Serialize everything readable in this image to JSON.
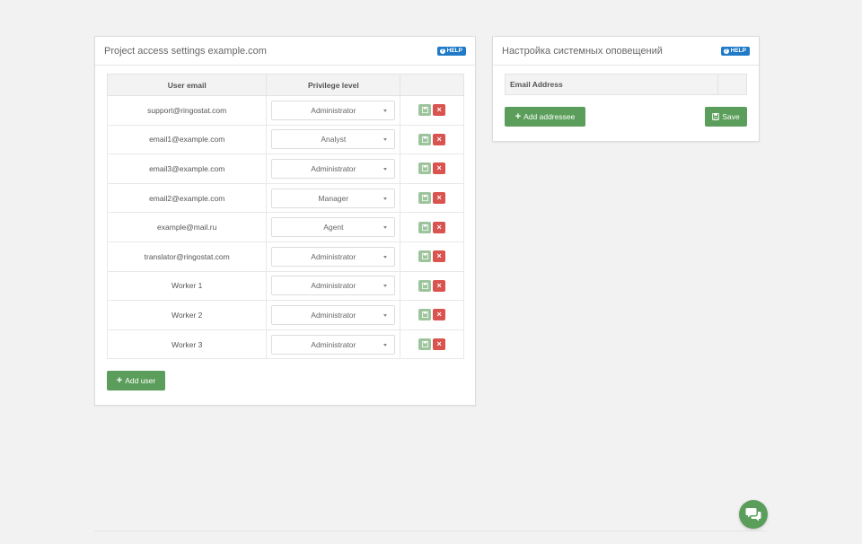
{
  "access_panel": {
    "title": "Project access settings example.com",
    "help_label": "HELP",
    "table": {
      "headers": [
        "User email",
        "Privilege level",
        ""
      ],
      "rows": [
        {
          "email": "support@ringostat.com",
          "privilege": "Administrator"
        },
        {
          "email": "email1@example.com",
          "privilege": "Analyst"
        },
        {
          "email": "email3@example.com",
          "privilege": "Administrator"
        },
        {
          "email": "email2@example.com",
          "privilege": "Manager"
        },
        {
          "email": "example@mail.ru",
          "privilege": "Agent"
        },
        {
          "email": "translator@ringostat.com",
          "privilege": "Administrator"
        },
        {
          "email": "Worker 1",
          "privilege": "Administrator"
        },
        {
          "email": "Worker 2",
          "privilege": "Administrator"
        },
        {
          "email": "Worker 3",
          "privilege": "Administrator"
        }
      ]
    },
    "add_user_label": "Add user"
  },
  "notifications_panel": {
    "title": "Настройка системных оповещений",
    "help_label": "HELP",
    "table_header": "Email Address",
    "add_addressee_label": "Add addressee",
    "save_label": "Save"
  },
  "icons": {
    "help": "question-circle-icon",
    "row_save": "floppy-disk-icon",
    "row_delete": "close-icon",
    "add": "plus-icon",
    "save": "floppy-disk-icon",
    "chat": "chat-bubbles-icon"
  },
  "colors": {
    "help_badge": "#1f7ac8",
    "primary_green": "#5b9e5b",
    "row_save_green": "#9dc59d",
    "delete_red": "#d9534f",
    "background": "#f2f2f2"
  }
}
